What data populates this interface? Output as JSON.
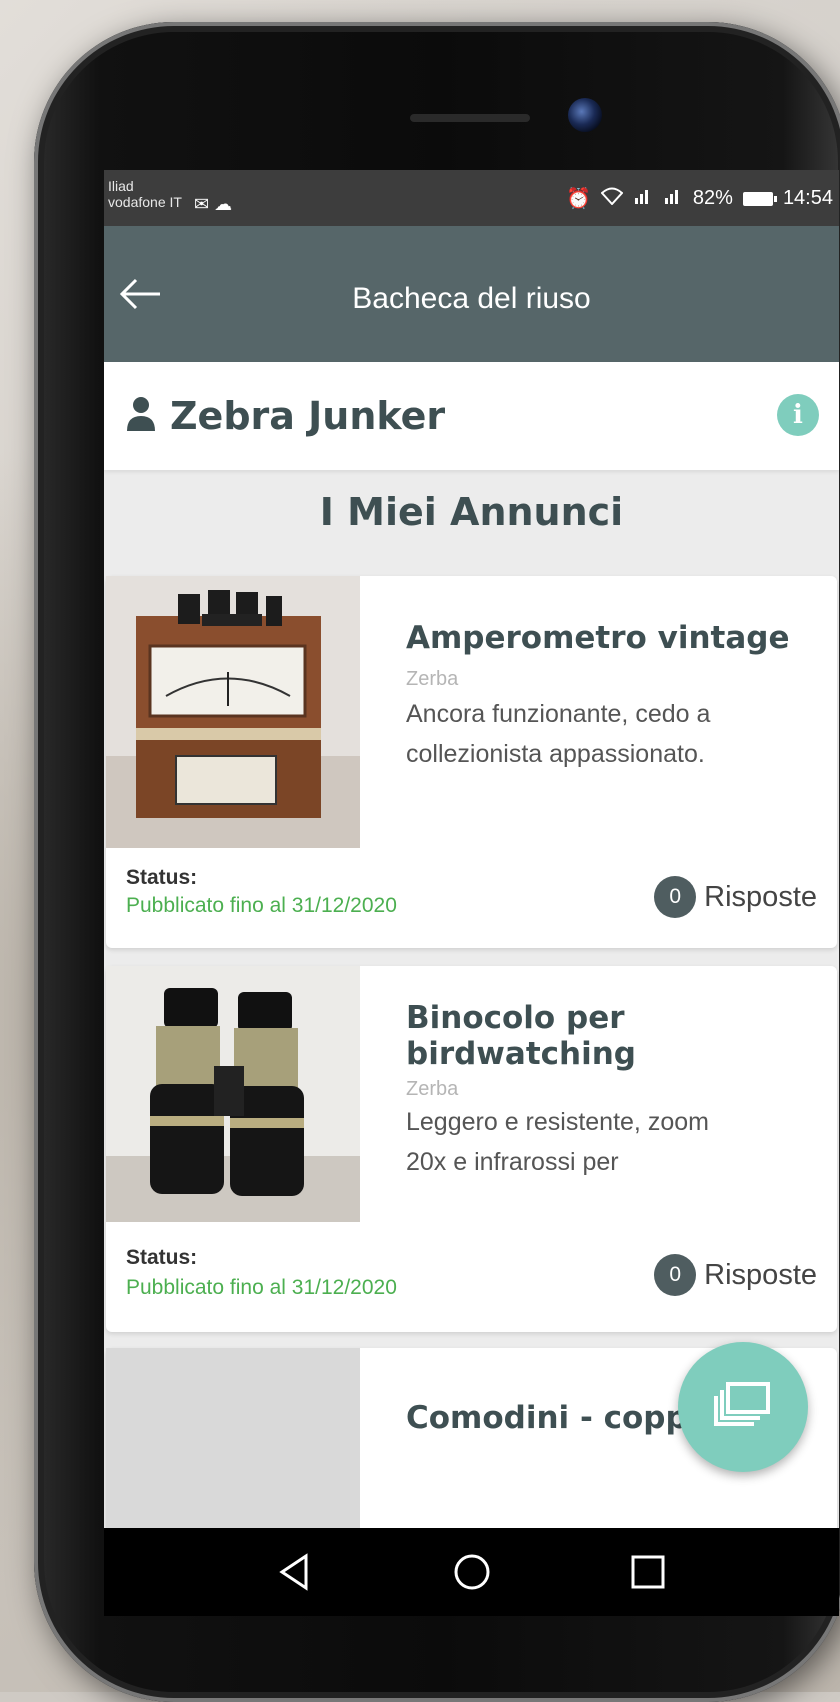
{
  "status_bar": {
    "carrier_1": "Iliad",
    "carrier_2": "vodafone IT",
    "battery": "82%",
    "time": "14:54"
  },
  "app_bar": {
    "title": "Bacheca del riuso"
  },
  "user": {
    "name": "Zebra Junker"
  },
  "section_title": "I Miei Annunci",
  "listings": [
    {
      "title": "Amperometro vintage",
      "location": "Zerba",
      "description_line_1": "Ancora funzionante, cedo a",
      "description_line_2": "collezionista appassionato.",
      "status_label": "Status:",
      "status_value": "Pubblicato fino al 31/12/2020",
      "reply_count": "0",
      "reply_label": "Risposte"
    },
    {
      "title_line_1": "Binocolo per",
      "title_line_2": "birdwatching",
      "location": "Zerba",
      "description_line_1": "Leggero e resistente, zoom",
      "description_line_2": "20x e infrarossi per",
      "status_label": "Status:",
      "status_value": "Pubblicato fino al 31/12/2020",
      "reply_count": "0",
      "reply_label": "Risposte"
    },
    {
      "title": "Comodini - coppia"
    }
  ],
  "colors": {
    "app_bar": "#566669",
    "accent": "#7fcdbd",
    "status_green": "#4caf50",
    "title_text": "#3e4f52"
  },
  "icons": {
    "back": "arrow-left-icon",
    "user": "user-icon",
    "info": "info-icon",
    "fab": "gallery-icon",
    "nav_back": "triangle-back-icon",
    "nav_home": "circle-home-icon",
    "nav_recents": "square-recents-icon"
  }
}
